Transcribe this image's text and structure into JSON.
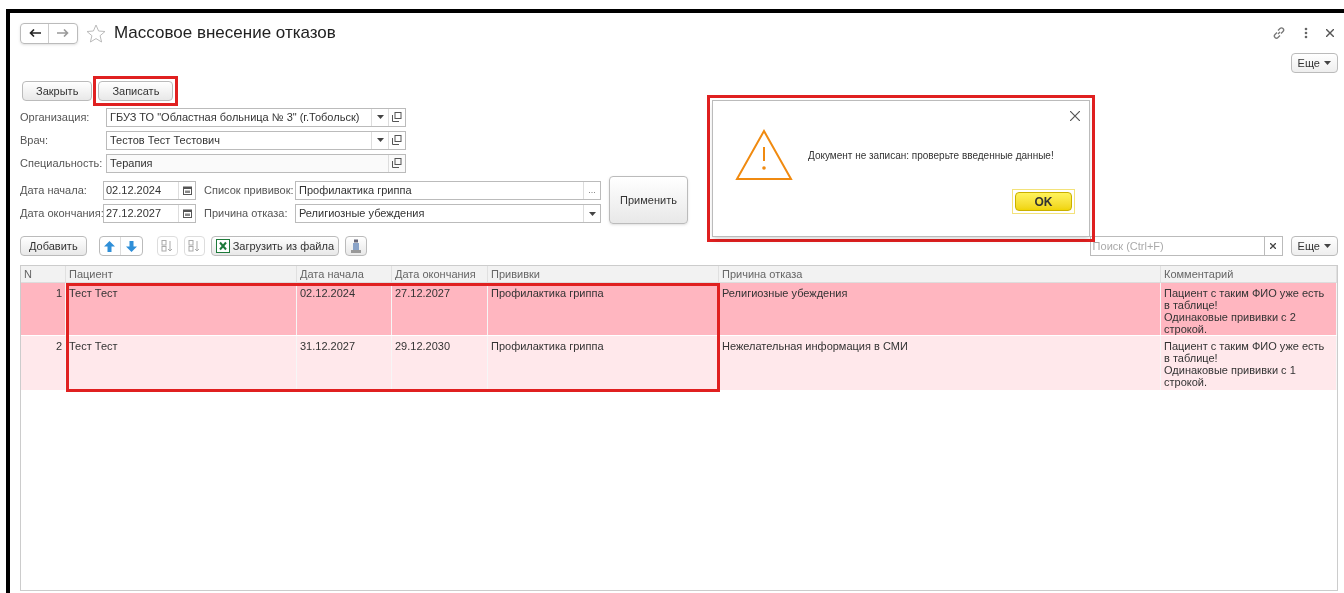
{
  "window": {
    "title": "Массовое внесение отказов",
    "favorite": false,
    "more_button": "Еще"
  },
  "command_bar": {
    "buttons": [
      {
        "label": "Закрыть",
        "highlighted": false
      },
      {
        "label": "Записать",
        "highlighted": true
      }
    ]
  },
  "fields": [
    {
      "label": "Организация:",
      "value": "ГБУЗ ТО \"Областная больница № 3\" (г.Тобольск)",
      "dropdown": true
    },
    {
      "label": "Врач:",
      "value": "Тестов Тест Тестович",
      "dropdown": true
    },
    {
      "label": "Специальность:",
      "value": "Терапия",
      "dropdown": false
    }
  ],
  "dates": [
    {
      "label": "Дата начала:",
      "value": "02.12.2024",
      "side_label": "Список прививок:",
      "side_value": "Профилактика гриппа",
      "kind": "choice",
      "button_text": "..."
    },
    {
      "label": "Дата окончания:",
      "value": "27.12.2027",
      "side_label": "Причина отказа:",
      "side_value": "Религиозные убеждения",
      "kind": "dropdown"
    }
  ],
  "apply_button": "Применить",
  "dialog": {
    "message": "Документ не записан: проверьте введенные данные!",
    "ok": "OK"
  },
  "toolbar": {
    "add": "Добавить",
    "load": "Загрузить из файла",
    "search_placeholder": "Поиск (Ctrl+F)",
    "more": "Еще"
  },
  "table": {
    "columns": [
      "N",
      "Пациент",
      "Дата начала",
      "Дата окончания",
      "Прививки",
      "Причина отказа",
      "Комментарий"
    ],
    "rows": [
      {
        "cells": [
          "1",
          "Тест Тест",
          "02.12.2024",
          "27.12.2027",
          "Профилактика гриппа",
          "Религиозные убеждения",
          "Пациент с таким ФИО уже есть в таблице!\n Одинаковые прививки с 2 строкой."
        ],
        "selected": true
      },
      {
        "cells": [
          "2",
          "Тест Тест",
          "31.12.2027",
          "29.12.2030",
          "Профилактика гриппа",
          "Нежелательная информация в СМИ",
          "Пациент с таким ФИО уже есть в таблице!\n Одинаковые прививки с 1 строкой."
        ],
        "selected": false
      }
    ]
  }
}
